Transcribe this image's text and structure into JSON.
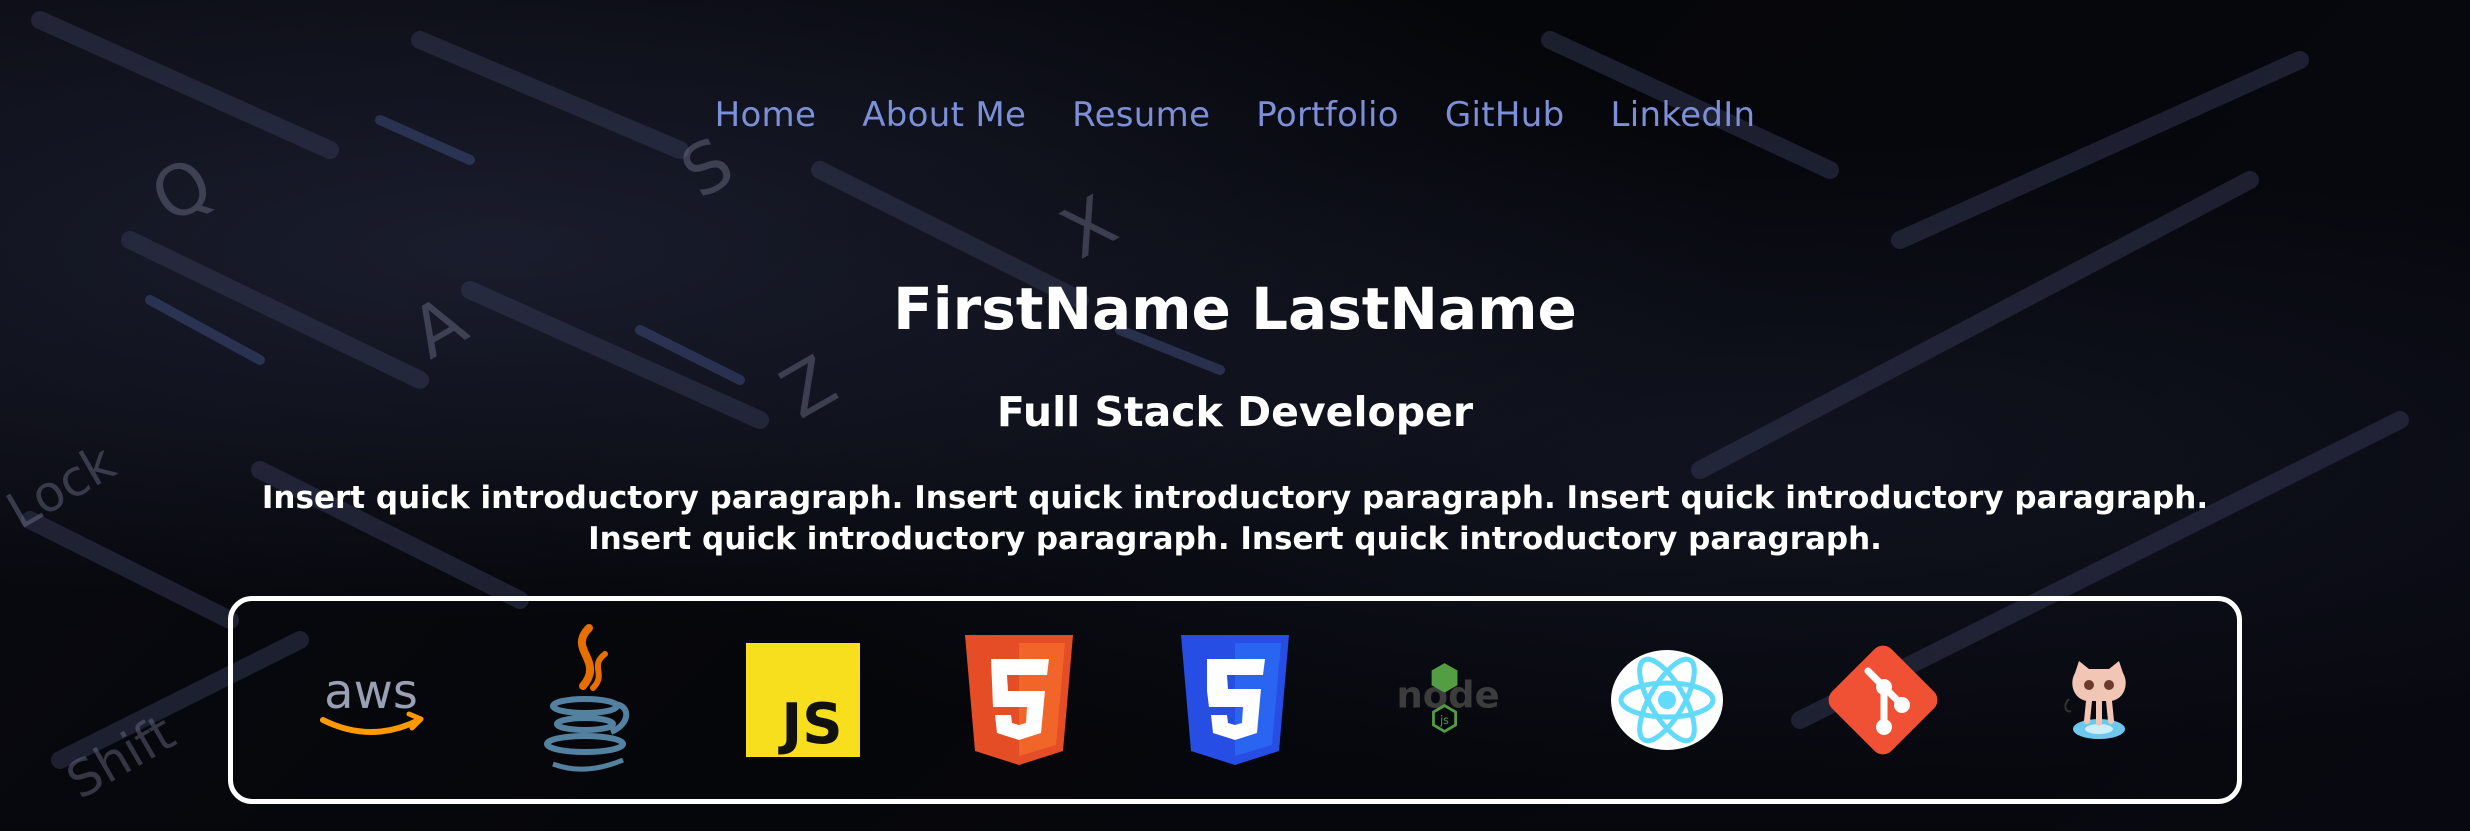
{
  "nav": {
    "items": [
      {
        "label": "Home"
      },
      {
        "label": "About Me"
      },
      {
        "label": "Resume"
      },
      {
        "label": "Portfolio"
      },
      {
        "label": "GitHub"
      },
      {
        "label": "LinkedIn"
      }
    ],
    "link_color": "#7d8fd6"
  },
  "hero": {
    "name": "FirstName LastName",
    "role": "Full Stack Developer",
    "intro": "Insert quick introductory paragraph. Insert quick introductory paragraph. Insert quick introductory paragraph. Insert quick introductory paragraph. Insert quick introductory paragraph."
  },
  "tech_stack": {
    "icons": [
      {
        "icon": "aws-icon"
      },
      {
        "icon": "java-icon"
      },
      {
        "icon": "javascript-icon",
        "text": "JS"
      },
      {
        "icon": "html5-icon",
        "text": "5"
      },
      {
        "icon": "css3-icon",
        "text": "3"
      },
      {
        "icon": "nodejs-icon",
        "text": "node"
      },
      {
        "icon": "react-icon"
      },
      {
        "icon": "git-icon"
      },
      {
        "icon": "github-octocat-icon"
      }
    ],
    "aws_text": "aws",
    "js_text": "JS",
    "node_text": "node",
    "node_js_badge": "js"
  },
  "colors": {
    "background": "#000000",
    "text": "#ffffff",
    "aws_orange": "#ff9900",
    "java_orange": "#e76f00",
    "java_blue": "#5382a1",
    "js_yellow": "#f7df1e",
    "html_orange": "#e44d26",
    "css_blue": "#264de4",
    "node_green": "#539e43",
    "react_cyan": "#61dafb",
    "git_red": "#f05033"
  }
}
